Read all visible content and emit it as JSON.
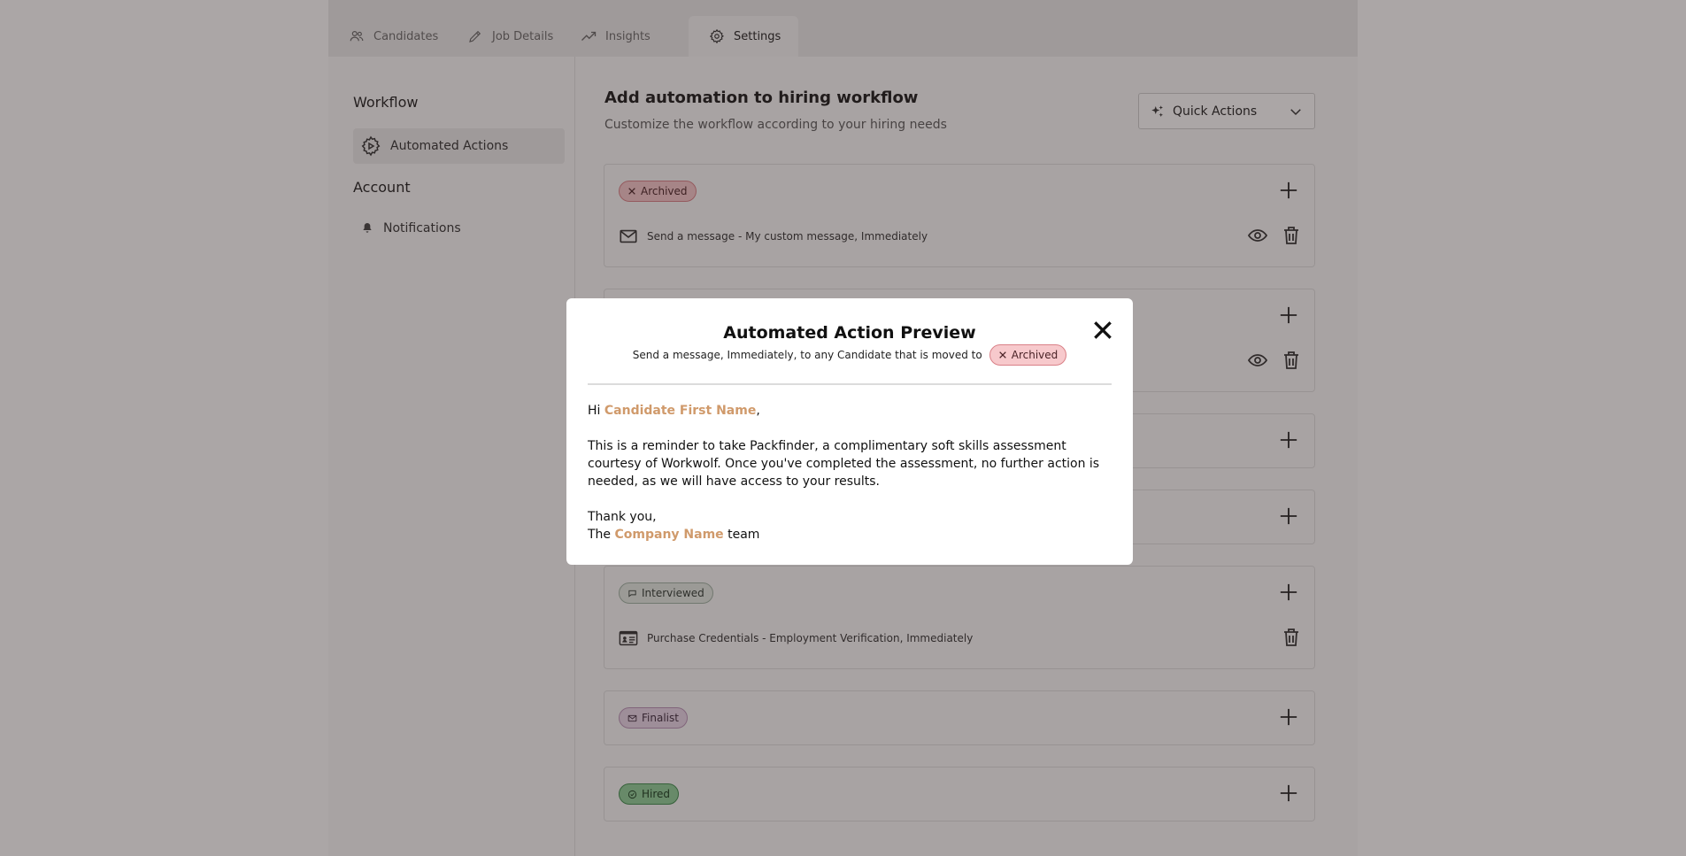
{
  "tabs": [
    {
      "label": "Candidates",
      "icon": "users-icon"
    },
    {
      "label": "Job Details",
      "icon": "pencil-icon"
    },
    {
      "label": "Insights",
      "icon": "trending-up-icon"
    },
    {
      "label": "Settings",
      "icon": "gear-icon",
      "active": true
    }
  ],
  "sidebar": {
    "workflow_heading": "Workflow",
    "automated_actions": "Automated Actions",
    "account_heading": "Account",
    "notifications": "Notifications"
  },
  "main": {
    "title": "Add automation to hiring workflow",
    "subtitle": "Customize the workflow according to your hiring needs",
    "quick_actions": "Quick Actions"
  },
  "stages": [
    {
      "label": "Archived",
      "action": "Send a message - My custom message, Immediately"
    },
    {
      "label": "Interviewed",
      "action": "Purchase Credentials - Employment Verification, Immediately"
    },
    {
      "label": "Finalist"
    },
    {
      "label": "Hired"
    }
  ],
  "modal": {
    "title": "Automated Action Preview",
    "subtitle": "Send a message, Immediately, to any Candidate that is moved to",
    "badge": "Archived",
    "greeting": "Hi",
    "first_name_var": "Candidate First Name",
    "comma": ",",
    "paragraph": "This is a reminder to take Packfinder, a complimentary soft skills assessment courtesy of Workwolf. Once you've completed the assessment, no further action is needed, as we will have access to your results.",
    "thanks": "Thank you,",
    "sign_pre": "The",
    "company_var": "Company Name",
    "sign_post": "team"
  },
  "colors": {
    "archived_bg": "#f7c9cc",
    "archived_border": "#d98087",
    "interviewed_bg": "#e4ebe5",
    "interviewed_border": "#9fb3a4",
    "finalist_bg": "#ead8ea",
    "finalist_border": "#b993b8",
    "hired_bg": "#8fd19a",
    "hired_border": "#3f8c4d",
    "variable": "#d09a6b"
  }
}
